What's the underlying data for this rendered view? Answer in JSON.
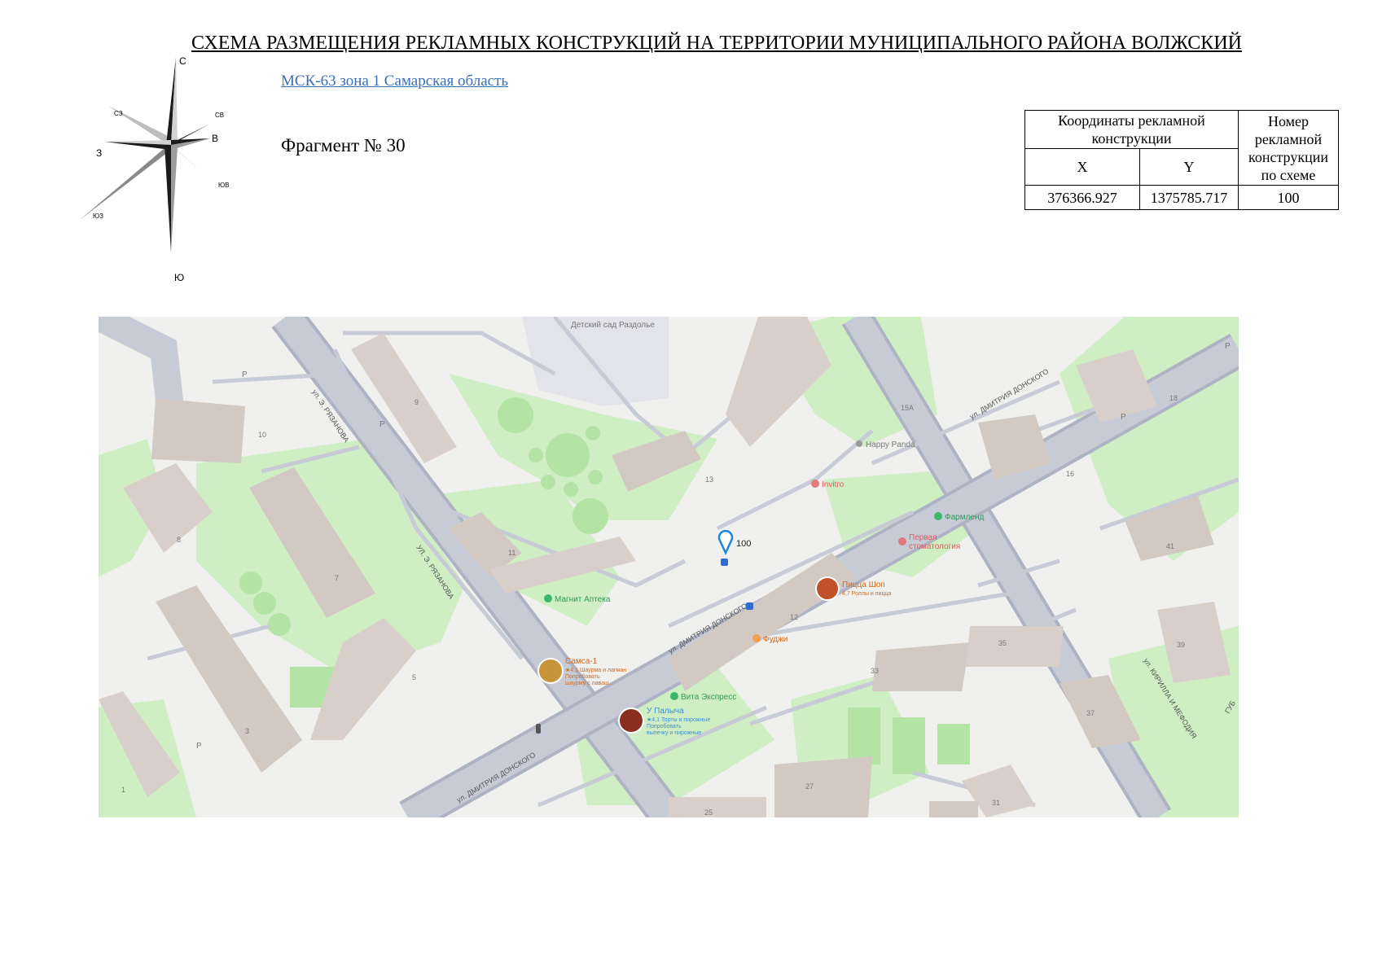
{
  "title": "СХЕМА РАЗМЕЩЕНИЯ РЕКЛАМНЫХ КОНСТРУКЦИЙ НА ТЕРРИТОРИИ МУНИЦИПАЛЬНОГО РАЙОНА ВОЛЖСКИЙ",
  "crs_link": "МСК-63 зона 1 Самарская область",
  "fragment": "Фрагмент № 30",
  "compass": {
    "n": "С",
    "s": "Ю",
    "e": "В",
    "w": "З",
    "ne": "СВ",
    "nw": "СЗ",
    "se": "ЮВ",
    "sw": "ЮЗ"
  },
  "table": {
    "header_coords": "Координаты рекламной конструкции",
    "header_number": "Номер рекламной конструкции по схеме",
    "col_x": "X",
    "col_y": "Y",
    "row": {
      "x": "376366.927",
      "y": "1375785.717",
      "number": "100"
    }
  },
  "map": {
    "marker_label": "100",
    "streets": {
      "ryazanova_top": "ул. Э. РЯЗАНОВА",
      "ryazanova_mid": "УЛ. Э. РЯЗАНОВА",
      "donskogo_main": "ул. ДМИТРИЯ ДОНСКОГО",
      "donskogo_right": "ул. ДМИТРИЯ ДОНСКОГО",
      "donskogo_bottom": "ул. ДМИТРИЯ ДОНСКОГО",
      "kirilla": "ул. КИРИЛЛА И МЕФОДИЯ",
      "gub": "ГУБ"
    },
    "pois": {
      "kindergarten": "Детский сад Раздолье",
      "happy_panda": "Happy Panda",
      "invitro": "Invitro",
      "farmlend": "Фармленд",
      "dentistry_1": "Первая",
      "dentistry_2": "стоматология",
      "pizza": "Пицца Шоп",
      "pizza_sub": "4,7 Роллы и пицца",
      "magnit": "Магнит Аптека",
      "fuji": "Фуджи",
      "samsa": "Самса-1",
      "samsa_sub1": "★4,1 Шаурма и лагман",
      "samsa_sub2": "Попробовать",
      "samsa_sub3": "шаурму с лаваш..",
      "vita": "Вита Экспресс",
      "upalycha": "У Палыча",
      "upalycha_sub1": "★4,1 Торты и пирожные",
      "upalycha_sub2": "Попробовать",
      "upalycha_sub3": "выпечку и пирожные"
    },
    "buildings": [
      "9",
      "10",
      "8",
      "7",
      "3",
      "1",
      "5",
      "11",
      "13",
      "15А",
      "12",
      "33",
      "35",
      "27",
      "25",
      "16",
      "18",
      "41",
      "39",
      "37",
      "31"
    ],
    "parking": "Р"
  }
}
